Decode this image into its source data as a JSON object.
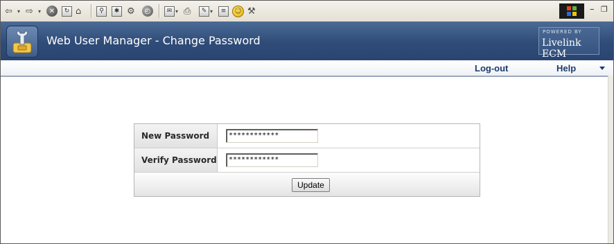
{
  "browser_toolbar": {
    "icons": [
      "back-icon",
      "dropdown-icon",
      "forward-icon",
      "dropdown-icon",
      "stop-icon",
      "refresh-icon",
      "home-icon",
      "search-icon",
      "favorites-icon",
      "media-icon",
      "history-icon",
      "mail-icon",
      "print-icon",
      "edit-icon",
      "discuss-icon",
      "messenger-icon",
      "tools-icon"
    ],
    "window_controls": {
      "minimize": "–",
      "restore": "Ǻ"
    }
  },
  "banner": {
    "title": "Web User Manager - Change Password",
    "powered_small": "POWERED BY",
    "powered_brand": "Livelink ECM"
  },
  "nav": {
    "logout_label": "Log-out",
    "help_label": "Help"
  },
  "form": {
    "new_password_label": "New Password",
    "new_password_value": "************",
    "verify_password_label": "Verify Password",
    "verify_password_value": "************",
    "update_label": "Update"
  },
  "colors": {
    "banner": "#2f4c78",
    "nav_text": "#1d3a6b",
    "label_bg": "#e8e8e8"
  }
}
